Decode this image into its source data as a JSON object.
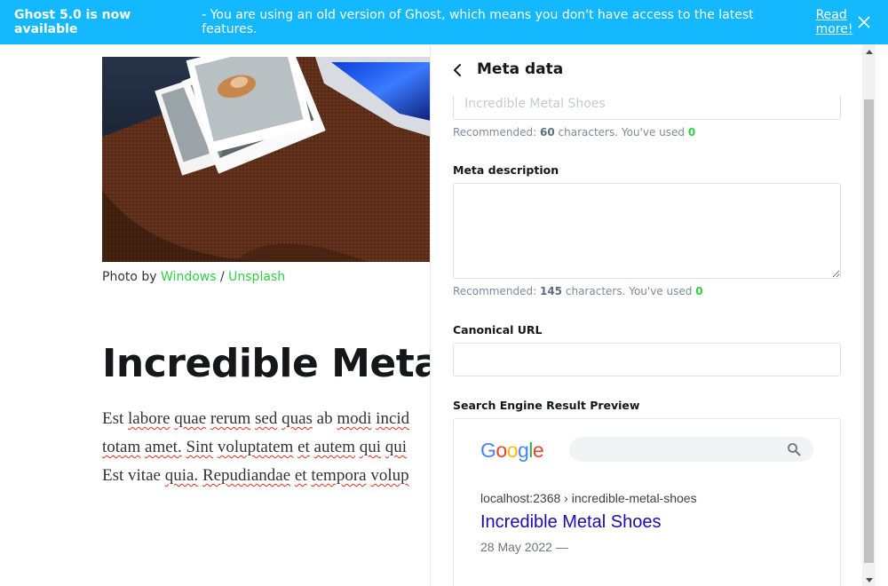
{
  "banner": {
    "title": "Ghost 5.0 is now available",
    "message": "- You are using an old version of Ghost, which means you don't have access to the latest features.",
    "link": "Read more!",
    "bg_color": "#14b8ff"
  },
  "editor": {
    "caption_prefix": "Photo by",
    "caption_author": "Windows",
    "caption_sep": "/",
    "caption_source": "Unsplash",
    "post_title": "Incredible Metal",
    "body_lines": [
      [
        "Est",
        "labore",
        "quae",
        "rerum",
        "sed",
        "quas",
        "ab",
        "modi",
        "incid"
      ],
      [
        "totam",
        "amet.",
        "Sint",
        "voluptatem",
        "et",
        "autem",
        "qui",
        "qui"
      ],
      [
        "Est",
        "vitae",
        "quia.",
        "Repudiandae",
        "et",
        "tempora",
        "volup"
      ]
    ]
  },
  "panel": {
    "title": "Meta data",
    "meta_title_placeholder": "Incredible Metal Shoes",
    "title_hint": {
      "prefix": "Recommended:",
      "count": "60",
      "suffix": "characters. You've used",
      "used": "0"
    },
    "meta_description_label": "Meta description",
    "description_hint": {
      "prefix": "Recommended:",
      "count": "145",
      "suffix": "characters. You've used",
      "used": "0"
    },
    "canonical_label": "Canonical URL",
    "preview_label": "Search Engine Result Preview"
  },
  "serp": {
    "logo": "Google",
    "url": "localhost:2368 › incredible-metal-shoes",
    "title": "Incredible Metal Shoes",
    "date": "28 May 2022 —",
    "title_color": "#1a0dab"
  }
}
